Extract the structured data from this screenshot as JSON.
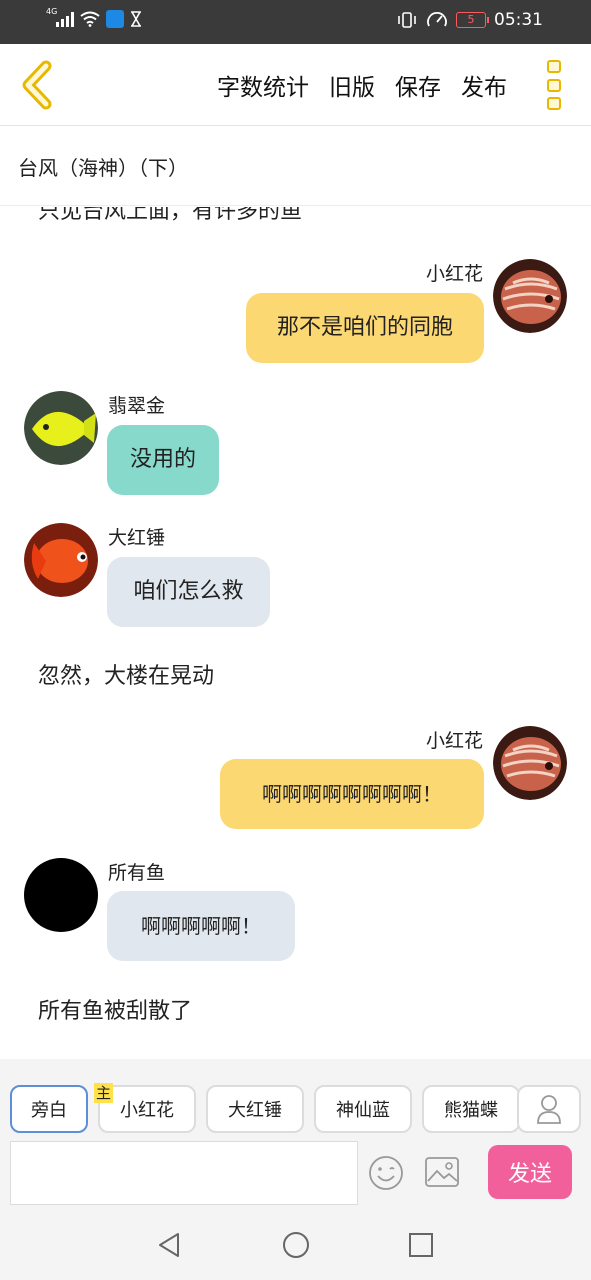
{
  "status_bar": {
    "network": "4G",
    "time": "05:31",
    "battery": "5"
  },
  "toolbar": {
    "actions": [
      "字数统计",
      "旧版",
      "保存",
      "发布"
    ]
  },
  "title": "台风（海神）（下）",
  "chat": {
    "cut_off_line": "只见台风上面，有许多的鱼",
    "items": [
      {
        "kind": "message",
        "side": "right",
        "name": "小红花",
        "text": "那不是咱们的同胞",
        "bubble_color": "#fcd873",
        "avatar": "discus-fish-avatar"
      },
      {
        "kind": "message",
        "side": "left",
        "name": "翡翠金",
        "text": "没用的",
        "bubble_color": "#86d9cb",
        "avatar": "yellow-tang-fish-avatar"
      },
      {
        "kind": "message",
        "side": "left",
        "name": "大红锤",
        "text": "咱们怎么救",
        "bubble_color": "#e1e7ee",
        "avatar": "goldfish-avatar"
      },
      {
        "kind": "narration",
        "text": "忽然，大楼在晃动"
      },
      {
        "kind": "message",
        "side": "right",
        "name": "小红花",
        "text": "啊啊啊啊啊啊啊啊！",
        "bubble_color": "#fcd873",
        "avatar": "discus-fish-avatar"
      },
      {
        "kind": "message",
        "side": "left",
        "name": "所有鱼",
        "text": "啊啊啊啊啊！",
        "bubble_color": "#e1e7ee",
        "avatar": "black-circle-avatar"
      },
      {
        "kind": "narration",
        "text": "所有鱼被刮散了"
      }
    ]
  },
  "composer": {
    "roles": [
      "旁白",
      "小红花",
      "大红锤",
      "神仙蓝",
      "熊猫蝶"
    ],
    "active_role": "旁白",
    "host_badge": "主",
    "input_value": "",
    "send_label": "发送"
  },
  "colors": {
    "accent_yellow": "#e6b800",
    "send_pink": "#f2609b",
    "active_role_border": "#5b8fd6"
  }
}
